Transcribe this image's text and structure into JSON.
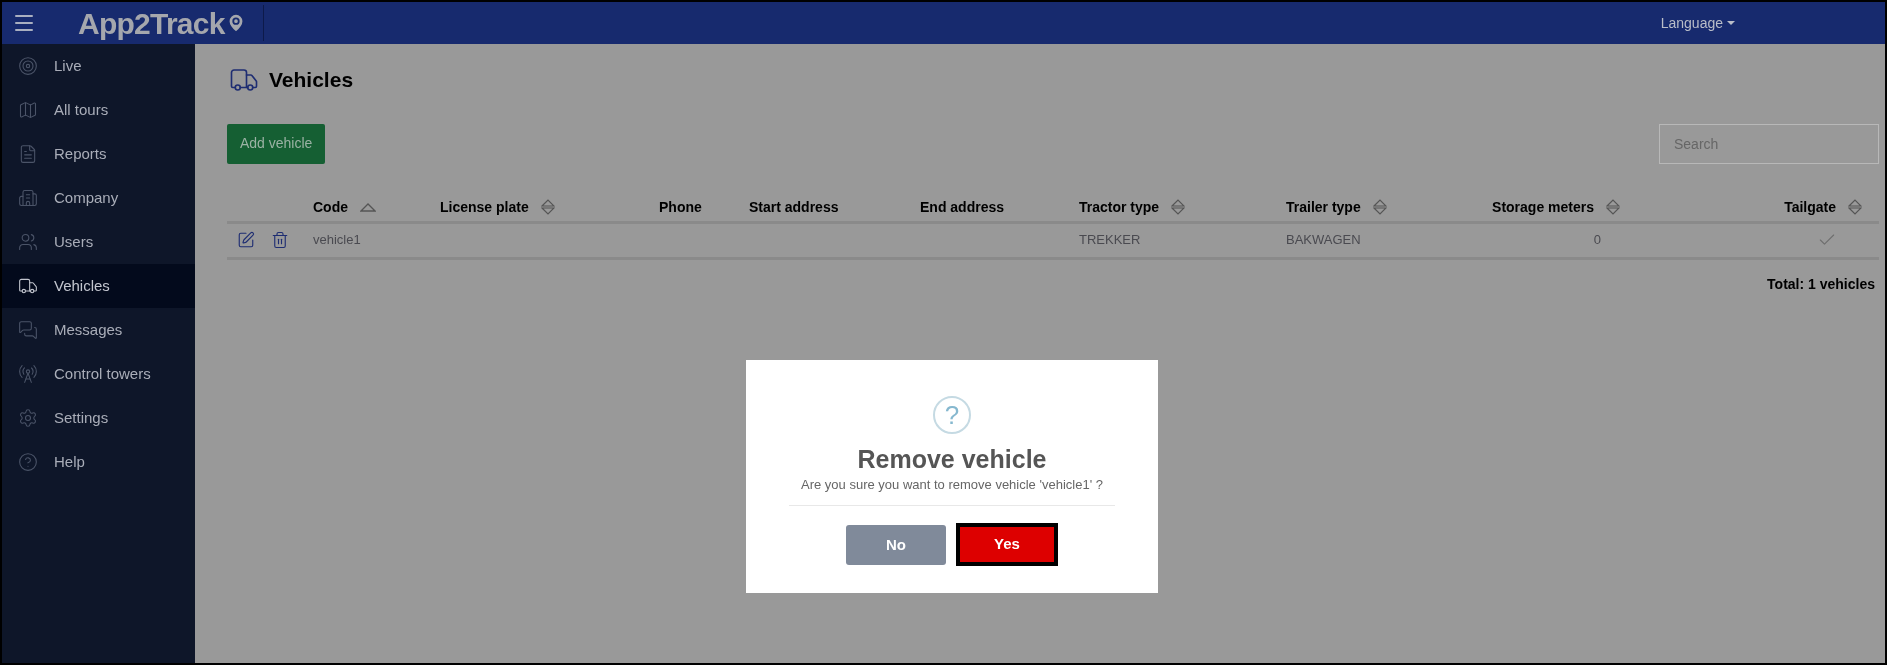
{
  "header": {
    "logo": "App2Track",
    "language_menu": "Language"
  },
  "sidebar": {
    "items": [
      {
        "label": "Live",
        "selected": false
      },
      {
        "label": "All tours",
        "selected": false
      },
      {
        "label": "Reports",
        "selected": false
      },
      {
        "label": "Company",
        "selected": false
      },
      {
        "label": "Users",
        "selected": false
      },
      {
        "label": "Vehicles",
        "selected": true
      },
      {
        "label": "Messages",
        "selected": false
      },
      {
        "label": "Control towers",
        "selected": false
      },
      {
        "label": "Settings",
        "selected": false
      },
      {
        "label": "Help",
        "selected": false
      }
    ]
  },
  "page": {
    "title": "Vehicles",
    "add_button": "Add vehicle",
    "search": {
      "placeholder": "Search"
    }
  },
  "table": {
    "columns": [
      {
        "label": "Code",
        "sorted_ascending": true
      },
      {
        "label": "License plate",
        "sorted_ascending": false
      },
      {
        "label": "Phone"
      },
      {
        "label": "Start address"
      },
      {
        "label": "End address"
      },
      {
        "label": "Tractor type",
        "sorted_ascending": false
      },
      {
        "label": "Trailer type",
        "sorted_ascending": false
      },
      {
        "label": "Storage meters",
        "sorted_ascending": false
      },
      {
        "label": "Tailgate",
        "sorted_ascending": false
      }
    ],
    "rows": [
      {
        "code": "vehicle1",
        "tractor_type": "TREKKER",
        "trailer_type": "BAKWAGEN",
        "storage_meters": "0",
        "tailgate": true
      }
    ],
    "total": "Total: 1 vehicles"
  },
  "dialog": {
    "icon_glyph": "?",
    "title": "Remove vehicle",
    "message": "Are you sure you want to remove vehicle 'vehicle1' ?",
    "buttons": [
      {
        "label": "No",
        "kind": "cancel"
      },
      {
        "label": "Yes",
        "kind": "confirm"
      }
    ]
  }
}
